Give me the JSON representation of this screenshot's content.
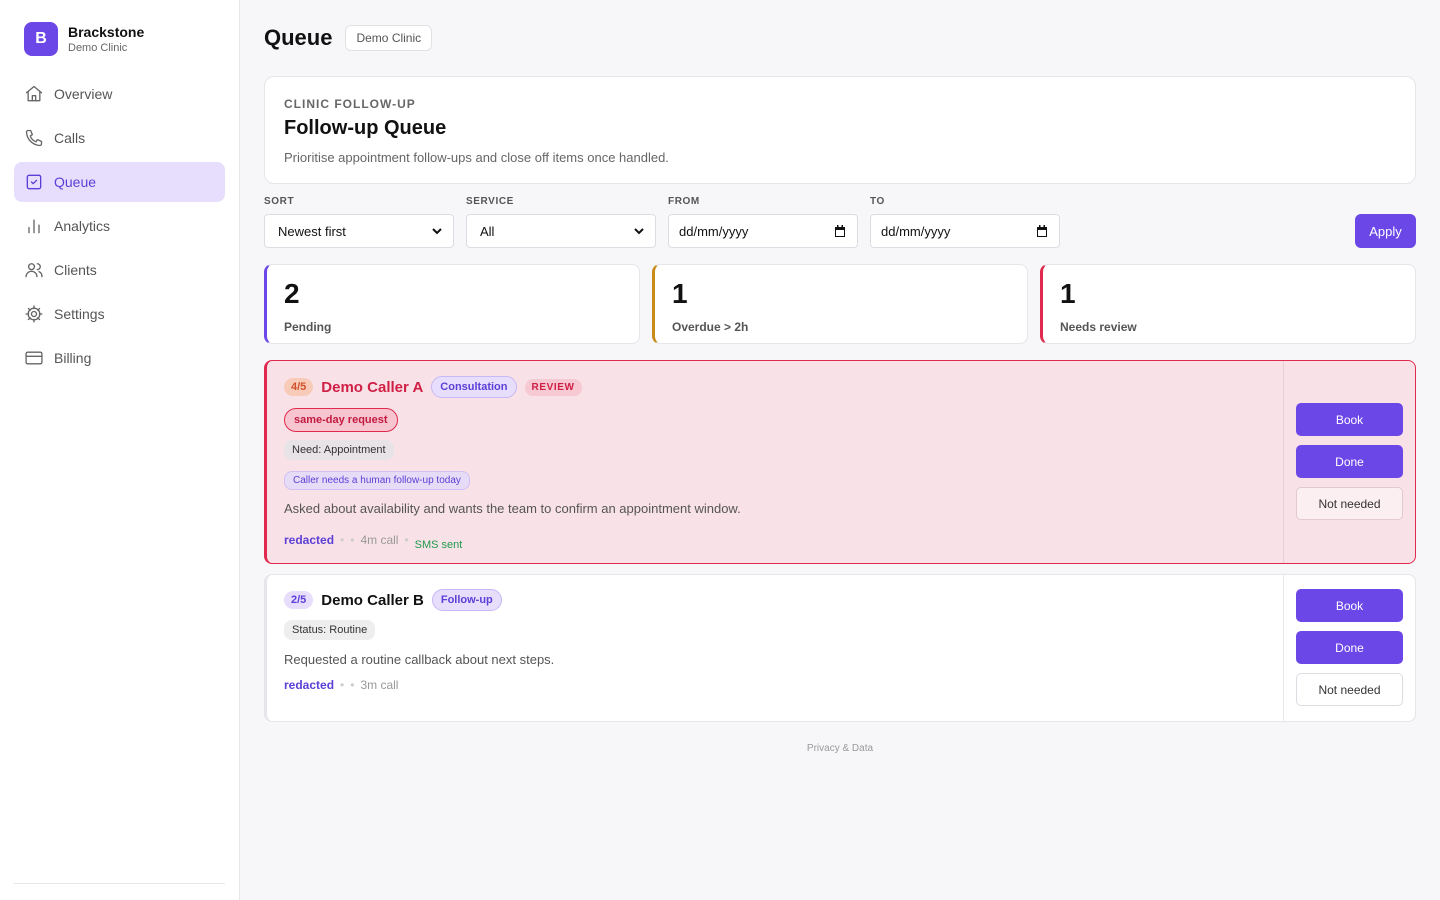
{
  "brand": {
    "initial": "B",
    "name": "Brackstone",
    "subtitle": "Demo Clinic"
  },
  "nav": [
    {
      "label": "Overview",
      "icon": "home-icon",
      "active": false
    },
    {
      "label": "Calls",
      "icon": "phone-icon",
      "active": false
    },
    {
      "label": "Queue",
      "icon": "checkbox-icon",
      "active": true
    },
    {
      "label": "Analytics",
      "icon": "bar-chart-icon",
      "active": false
    },
    {
      "label": "Clients",
      "icon": "users-icon",
      "active": false
    },
    {
      "label": "Settings",
      "icon": "gear-icon",
      "active": false
    },
    {
      "label": "Billing",
      "icon": "credit-card-icon",
      "active": false
    }
  ],
  "header": {
    "title": "Queue",
    "badge": "Demo Clinic"
  },
  "intro": {
    "kicker": "CLINIC FOLLOW-UP",
    "title": "Follow-up Queue",
    "description": "Prioritise appointment follow-ups and close off items once handled."
  },
  "filters": {
    "sort": {
      "label": "SORT",
      "value": "Newest first"
    },
    "service": {
      "label": "SERVICE",
      "value": "All"
    },
    "from": {
      "label": "FROM",
      "value": "dd/mm/yyyy"
    },
    "to": {
      "label": "TO",
      "value": "dd/mm/yyyy"
    },
    "apply_label": "Apply"
  },
  "stats": [
    {
      "value": "2",
      "label": "Pending",
      "color": "#6c47e8"
    },
    {
      "value": "1",
      "label": "Overdue > 2h",
      "color": "#c98a1c"
    },
    {
      "value": "1",
      "label": "Needs review",
      "color": "#e0294e"
    }
  ],
  "cards": [
    {
      "score": "4/5",
      "name": "Demo Caller A",
      "service": "Consultation",
      "review_badge": "REVIEW",
      "urgent_tag": "same-day request",
      "need_tag": "Need: Appointment",
      "flag_tag": "Caller needs a human follow-up today",
      "summary": "Asked about availability and wants the team to confirm an appointment window.",
      "caller_id": "redacted",
      "duration": "4m call",
      "sms_status": "SMS sent",
      "actions": {
        "book": "Book",
        "done": "Done",
        "not_needed": "Not needed"
      }
    },
    {
      "score": "2/5",
      "name": "Demo Caller B",
      "service": "Follow-up",
      "status_tag": "Status: Routine",
      "summary": "Requested a routine callback about next steps.",
      "caller_id": "redacted",
      "duration": "3m call",
      "actions": {
        "book": "Book",
        "done": "Done",
        "not_needed": "Not needed"
      }
    }
  ],
  "footer": {
    "link": "Privacy & Data"
  },
  "colors": {
    "accent": "#6c47e8",
    "danger": "#e0294e",
    "warning": "#c98a1c",
    "success": "#1f9a4e"
  }
}
